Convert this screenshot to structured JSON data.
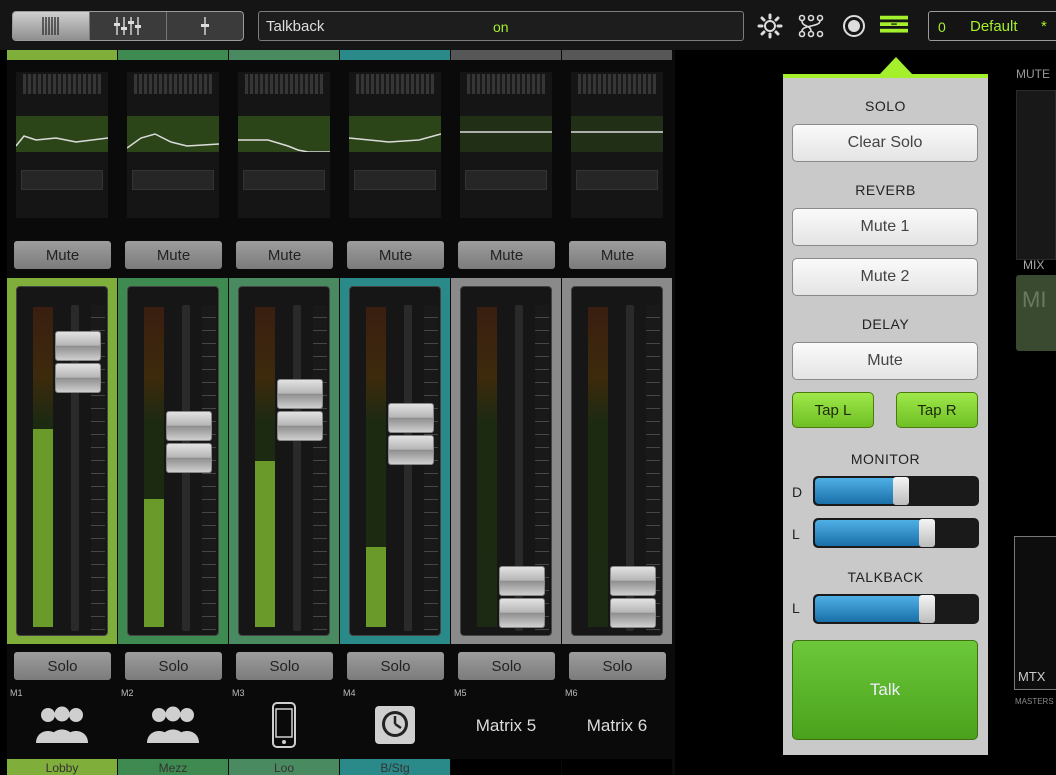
{
  "topbar": {
    "view_buttons": [
      "grid-view",
      "mixer-view",
      "single-channel-view"
    ],
    "talkback_label": "Talkback",
    "talkback_state": "on",
    "snapshot_number": "0",
    "snapshot_name": "Default",
    "snapshot_modified": "*"
  },
  "channels": [
    {
      "num": "M1",
      "mute": "Mute",
      "solo": "Solo",
      "name": "Lobby",
      "icon": "people-icon",
      "label": "",
      "color": "#7fae3a",
      "meter": 0.62,
      "fader": 0.93
    },
    {
      "num": "M2",
      "mute": "Mute",
      "solo": "Solo",
      "name": "Mezz",
      "icon": "people-icon",
      "label": "",
      "color": "#3f8a50",
      "meter": 0.4,
      "fader": 0.63
    },
    {
      "num": "M3",
      "mute": "Mute",
      "solo": "Solo",
      "name": "Loo",
      "icon": "phone-icon",
      "label": "",
      "color": "#4a8a60",
      "meter": 0.52,
      "fader": 0.75
    },
    {
      "num": "M4",
      "mute": "Mute",
      "solo": "Solo",
      "name": "B/Stg",
      "icon": "clock-icon",
      "label": "",
      "color": "#2a8a8a",
      "meter": 0.25,
      "fader": 0.66
    },
    {
      "num": "M5",
      "mute": "Mute",
      "solo": "Solo",
      "name": "",
      "icon": "",
      "label": "Matrix 5",
      "color": "#8a8a8a",
      "meter": 0.0,
      "fader": 0.04
    },
    {
      "num": "M6",
      "mute": "Mute",
      "solo": "Solo",
      "name": "",
      "icon": "",
      "label": "Matrix 6",
      "color": "#8a8a8a",
      "meter": 0.0,
      "fader": 0.04
    }
  ],
  "panel": {
    "solo_title": "SOLO",
    "clear_solo": "Clear Solo",
    "reverb_title": "REVERB",
    "reverb_mute1": "Mute 1",
    "reverb_mute2": "Mute 2",
    "delay_title": "DELAY",
    "delay_mute": "Mute",
    "tap_l": "Tap L",
    "tap_r": "Tap R",
    "monitor_title": "MONITOR",
    "monitor_d_label": "D",
    "monitor_l_label": "L",
    "monitor_d_level": 0.58,
    "monitor_l_level": 0.74,
    "talkback_title": "TALKBACK",
    "talkback_l_label": "L",
    "talkback_l_level": 0.74,
    "talk_button": "Talk"
  },
  "master": {
    "mute_label": "MUTE",
    "mix_label": "MIX",
    "mix_button": "MI",
    "mtx_label": "MTX",
    "masters_label": "MASTERS"
  },
  "colors": {
    "accent": "#a4f02c",
    "meter_green": "#6a9a2a",
    "slider_blue": "#2a8cc8",
    "talk_green": "#5ab82a"
  }
}
